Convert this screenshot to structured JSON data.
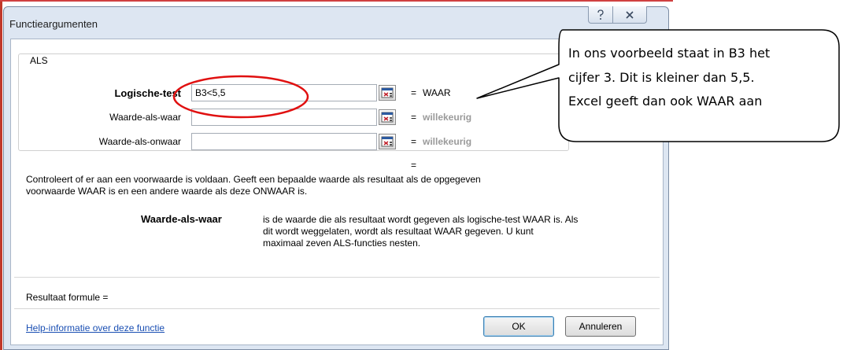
{
  "dialog": {
    "title": "Functieargumenten",
    "help_icon": "question-mark-icon",
    "close_icon": "close-icon"
  },
  "function_group": {
    "name": "ALS",
    "arguments": [
      {
        "label": "Logische-test",
        "value": "B3<5,5",
        "result": "WAAR",
        "bold": true
      },
      {
        "label": "Waarde-als-waar",
        "value": "",
        "result": "willekeurig",
        "bold": false
      },
      {
        "label": "Waarde-als-onwaar",
        "value": "",
        "result": "willekeurig",
        "bold": false
      }
    ],
    "overall_equals": "="
  },
  "description": {
    "function_text_line1": "Controleert of er aan een voorwaarde is voldaan. Geeft een bepaalde waarde als resultaat als de opgegeven",
    "function_text_line2": "voorwaarde WAAR is en een andere waarde als deze ONWAAR is.",
    "argument_name": "Waarde-als-waar",
    "argument_text_line1": "is de waarde die als resultaat wordt gegeven als logische-test WAAR is. Als",
    "argument_text_line2": "dit wordt weggelaten, wordt als resultaat WAAR gegeven. U kunt",
    "argument_text_line3": "maximaal zeven ALS-functies nesten."
  },
  "result_formula_label": "Resultaat formule =",
  "help_link": "Help-informatie over deze functie",
  "buttons": {
    "ok": "OK",
    "cancel": "Annuleren"
  },
  "callout": {
    "line1": "In ons voorbeeld staat in B3 het",
    "line2": "cijfer 3. Dit is kleiner dan 5,5.",
    "line3": "Excel geeft dan ook WAAR aan"
  },
  "colors": {
    "highlight_ellipse": "#e01010",
    "link": "#1a4fb3",
    "dialog_frame": "#dde6f2"
  }
}
